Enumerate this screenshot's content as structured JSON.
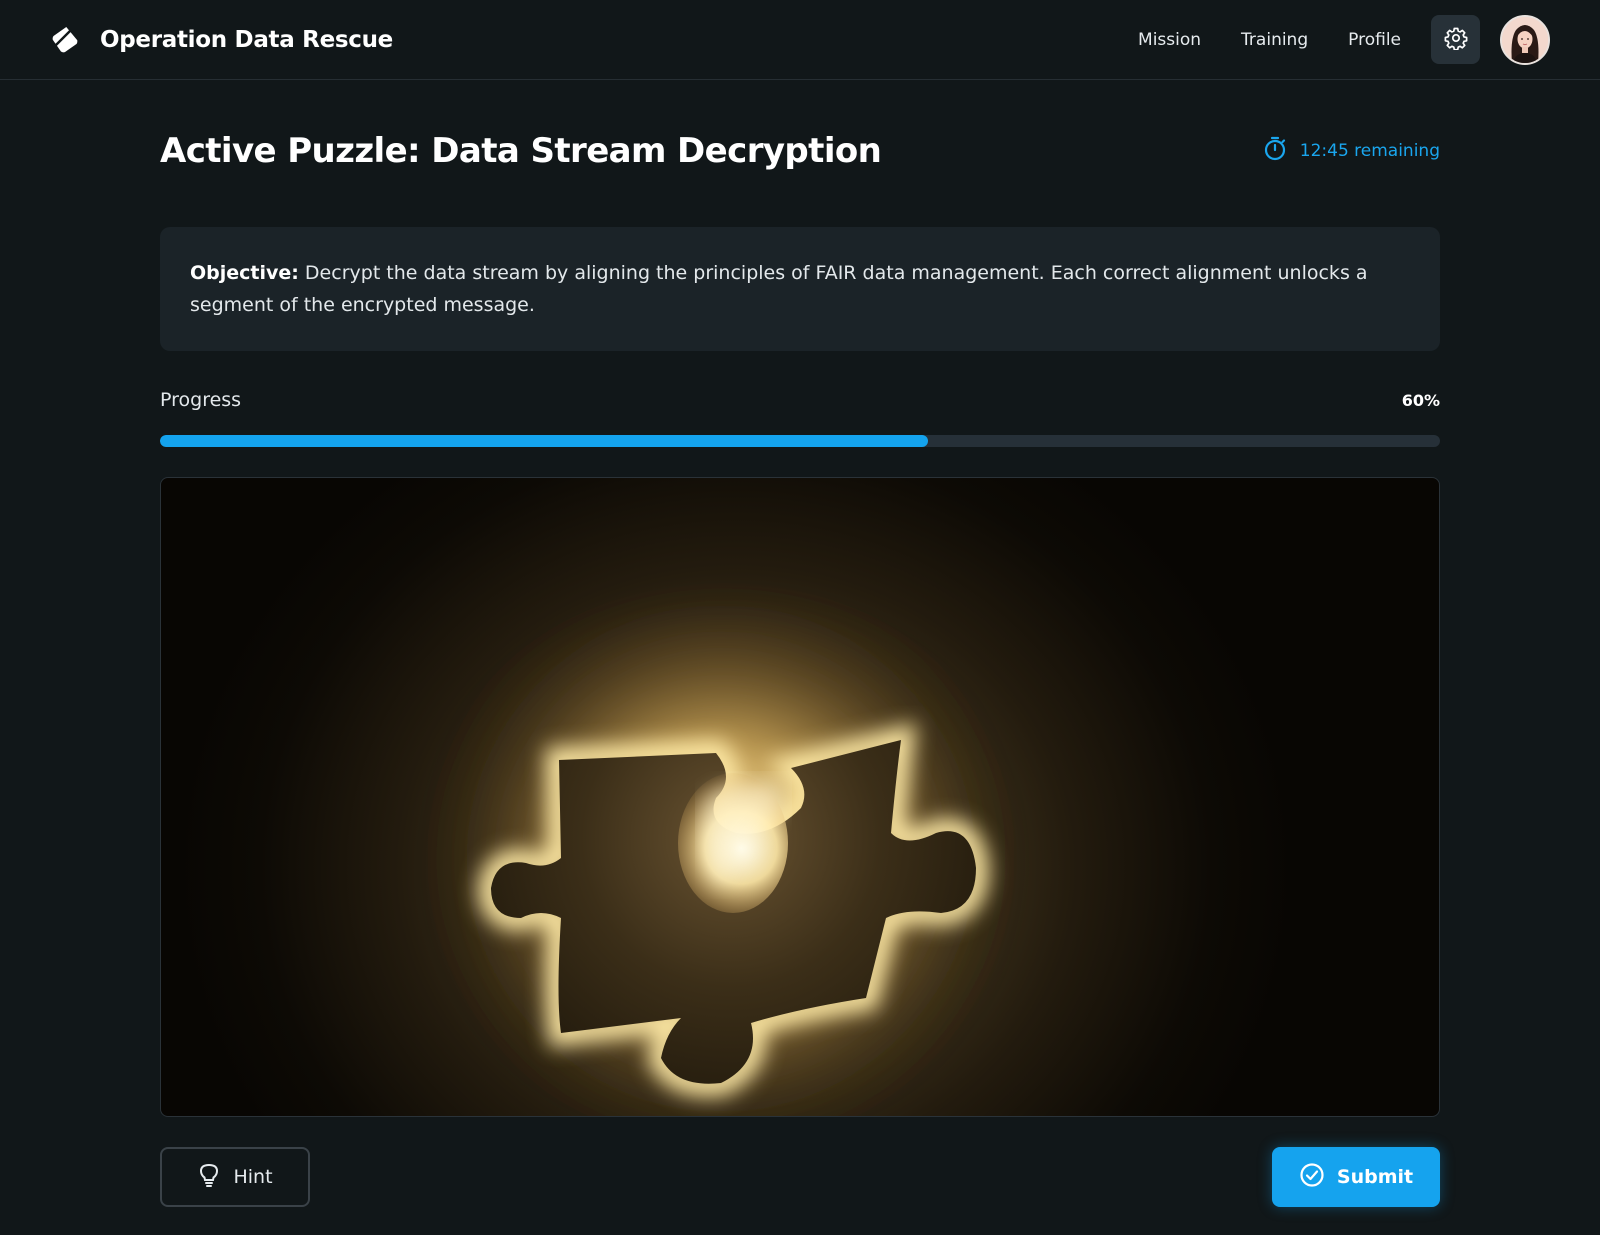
{
  "header": {
    "brand_title": "Operation Data Rescue",
    "brand_icon": "diamond-tag-icon",
    "nav": [
      {
        "label": "Mission"
      },
      {
        "label": "Training"
      },
      {
        "label": "Profile"
      }
    ],
    "settings_icon": "gear-icon"
  },
  "main": {
    "title": "Active Puzzle: Data Stream Decryption",
    "timer_text": "12:45 remaining",
    "timer_icon": "stopwatch-icon",
    "objective_label": "Objective:",
    "objective_text": " Decrypt the data stream by aligning the principles of FAIR data management. Each correct alignment unlocks a segment of the encrypted message.",
    "progress_label": "Progress",
    "progress_pct_text": "60%",
    "progress_value": 0.6,
    "hint_label": "Hint",
    "hint_icon": "lightbulb-icon",
    "submit_label": "Submit",
    "submit_icon": "check-circle-icon"
  },
  "colors": {
    "background": "#111719",
    "accent": "#15a3ee",
    "panel": "#1b2328",
    "track": "#263038"
  }
}
